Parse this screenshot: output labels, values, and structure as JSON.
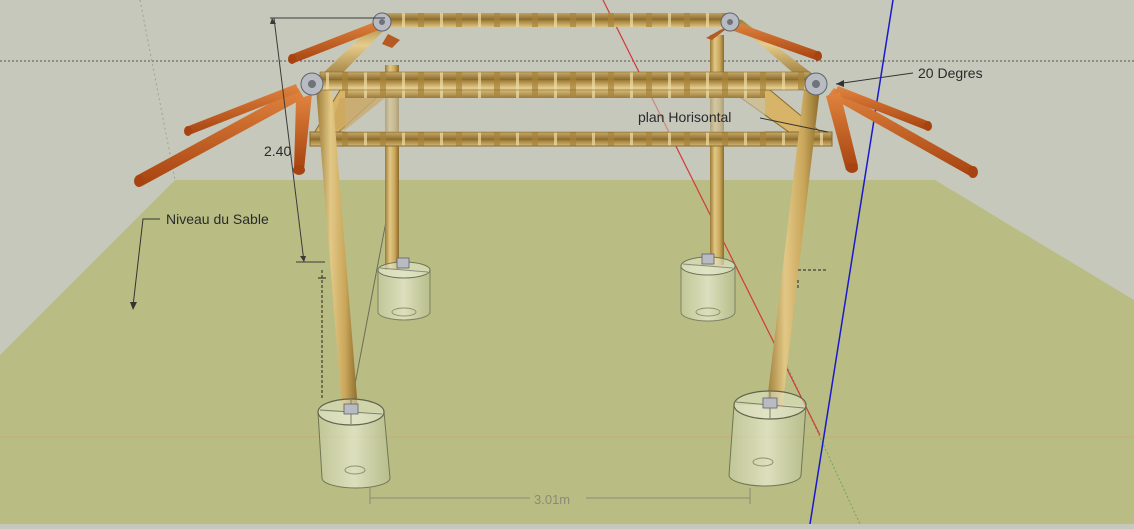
{
  "annotations": {
    "height_dimension": "2.40",
    "angle_label": "20 Degres",
    "plane_label": "plan Horisontal",
    "ground_label": "Niveau du Sable",
    "width_dimension": "3.01m"
  },
  "colors": {
    "sky": "#c5c8bb",
    "ground": "#b9bd84",
    "bamboo": "#c9a65a",
    "bamboo_node": "#8a6a2a",
    "rafter": "#c8601e",
    "rafter_end": "#a74310",
    "joint": "#b8bcc2",
    "axis_red": "#d23a3a",
    "axis_blue": "#1a1acc",
    "axis_green": "#6b9a4a",
    "container": "#dde4c0"
  }
}
